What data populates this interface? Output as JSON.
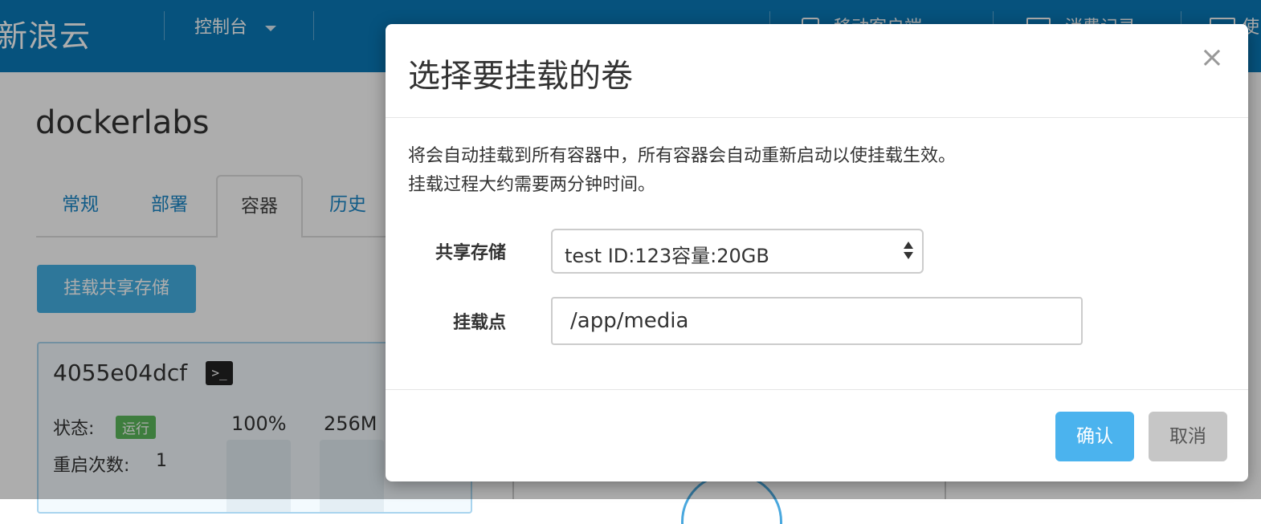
{
  "header": {
    "brand": "新浪云",
    "console_menu": "控制台",
    "mobile_menu": "移动客户端",
    "billing_menu": "消费记录",
    "extra_menu": "使"
  },
  "app": {
    "title": "dockerlabs",
    "tabs": [
      {
        "label": "常规",
        "active": false
      },
      {
        "label": "部署",
        "active": false
      },
      {
        "label": "容器",
        "active": true
      },
      {
        "label": "历史",
        "active": false
      }
    ],
    "mount_button": "挂载共享存储",
    "container": {
      "id": "4055e04dcf",
      "status_label": "状态:",
      "status_value": "运行",
      "cpu": "100%",
      "memory": "256M",
      "restart_label": "重启次数:",
      "restart_count": "1"
    }
  },
  "modal": {
    "title": "选择要挂载的卷",
    "close_glyph": "×",
    "description_line1": "将会自动挂载到所有容器中，所有容器会自动重新启动以使挂载生效。",
    "description_line2": "挂载过程大约需要两分钟时间。",
    "storage_label": "共享存储",
    "storage_selected": "test ID:123容量:20GB",
    "mount_point_label": "挂载点",
    "mount_point_value": "/app/media",
    "confirm_label": "确认",
    "cancel_label": "取消"
  },
  "colors": {
    "topbar": "#0a7ab8",
    "primary": "#45b0e3",
    "confirm": "#4bb3ee",
    "cancel": "#c6c6c6",
    "status_ok": "#5cb85c"
  }
}
